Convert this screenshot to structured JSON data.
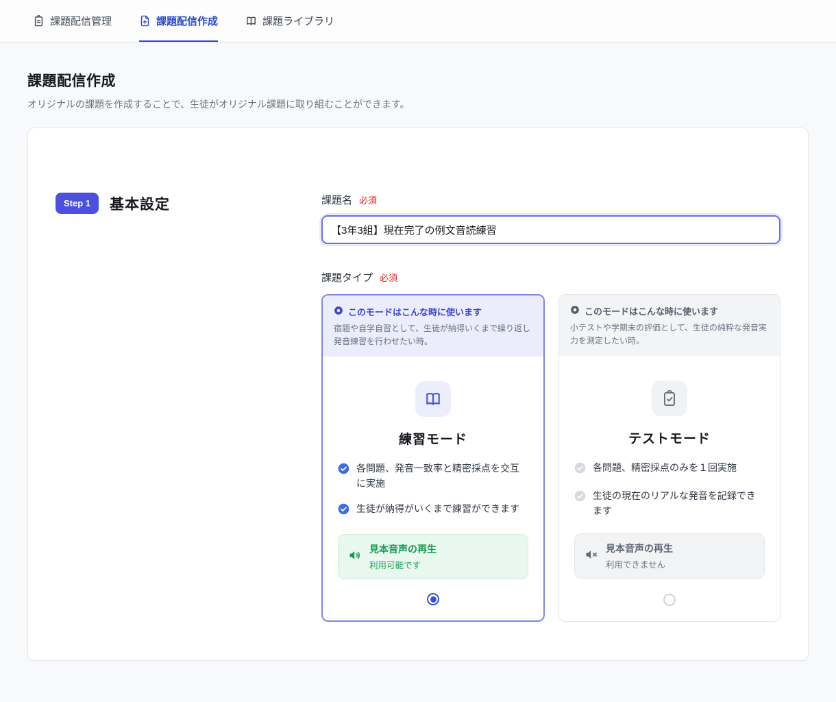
{
  "header": {
    "tabs": [
      {
        "label": "課題配信管理",
        "icon": "clipboard-list-icon",
        "active": false
      },
      {
        "label": "課題配信作成",
        "icon": "file-plus-icon",
        "active": true
      },
      {
        "label": "課題ライブラリ",
        "icon": "open-book-icon",
        "active": false
      }
    ]
  },
  "page": {
    "title": "課題配信作成",
    "subtitle": "オリジナルの課題を作成することで、生徒がオリジナル課題に取り組むことができます。"
  },
  "step": {
    "badge": "Step 1",
    "heading": "基本設定"
  },
  "task_name": {
    "label": "課題名",
    "required": "必須",
    "value": "【3年3組】現在完了の例文音読練習"
  },
  "task_type": {
    "label": "課題タイプ",
    "required": "必須"
  },
  "modes": [
    {
      "hint_title": "このモードはこんな時に使います",
      "hint_body": "宿題や自学自習として、生徒が納得いくまで繰り返し発音練習を行わせたい時。",
      "icon": "open-book-icon",
      "title": "練習モード",
      "features": [
        "各問題、発音一致率と精密採点を交互に実施",
        "生徒が納得がいくまで練習ができます"
      ],
      "audio_title": "見本音声の再生",
      "audio_status": "利用可能です",
      "audio_available": true,
      "selected": true
    },
    {
      "hint_title": "このモードはこんな時に使います",
      "hint_body": "小テストや学期末の評価として、生徒の純粋な発音実力を測定したい時。",
      "icon": "clipboard-check-icon",
      "title": "テストモード",
      "features": [
        "各問題、精密採点のみを１回実施",
        "生徒の現在のリアルな発音を記録できます"
      ],
      "audio_title": "見本音声の再生",
      "audio_status": "利用できません",
      "audio_available": false,
      "selected": false
    }
  ],
  "colors": {
    "accent_blue": "#2b4acb",
    "indigo": "#4b50df",
    "required_red": "#e02424",
    "success_green": "#169a4e",
    "muted_gray": "#6b7280"
  }
}
